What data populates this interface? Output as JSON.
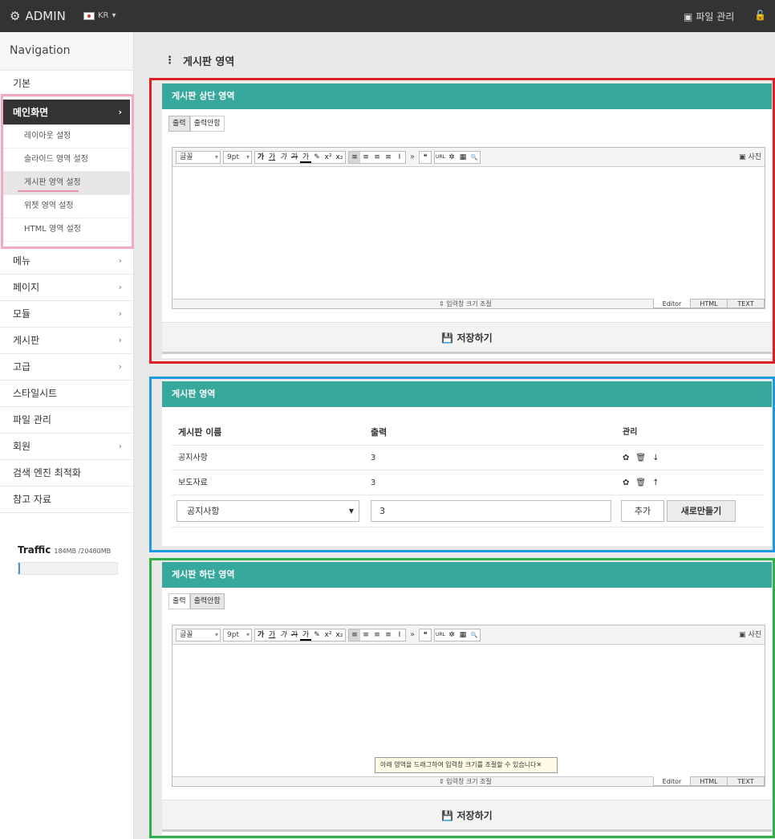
{
  "topbar": {
    "brand": "ADMIN",
    "lang": "KR",
    "file_manager": "파일 관리"
  },
  "sidebar": {
    "title": "Navigation",
    "items": [
      {
        "label": "기본"
      },
      {
        "label": "메인화면"
      },
      {
        "label": "메뉴"
      },
      {
        "label": "페이지"
      },
      {
        "label": "모듈"
      },
      {
        "label": "게시판"
      },
      {
        "label": "고급"
      },
      {
        "label": "스타일시트"
      },
      {
        "label": "파일 관리"
      },
      {
        "label": "회원"
      },
      {
        "label": "검색 엔진 최적화"
      },
      {
        "label": "참고 자료"
      }
    ],
    "sub_items": [
      {
        "label": "레이아웃 설정"
      },
      {
        "label": "슬라이드 영역 설정"
      },
      {
        "label": "게시판 영역 설정"
      },
      {
        "label": "위젯 영역 설정"
      },
      {
        "label": "HTML 영역 설정"
      }
    ],
    "traffic": {
      "label": "Traffic",
      "usage": "184MB /20480MB",
      "fill_fraction": 0.009
    }
  },
  "page": {
    "title": "게시판 영역"
  },
  "top_panel": {
    "title": "게시판 상단 영역",
    "toggle": [
      "출력",
      "출력안함"
    ],
    "save": "저장하기"
  },
  "board_panel": {
    "title": "게시판 영역",
    "headers": [
      "게시판 이름",
      "출력",
      "관리"
    ],
    "rows": [
      {
        "name": "공지사항",
        "count": "3"
      },
      {
        "name": "보도자료",
        "count": "3"
      }
    ],
    "select_value": "공지사항",
    "count_value": "3",
    "add": "추가",
    "new": "새로만들기"
  },
  "bottom_panel": {
    "title": "게시판 하단 영역",
    "toggle": [
      "출력",
      "출력안함"
    ],
    "save": "저장하기",
    "tooltip": "아래 영역을 드래그하여 입력창 크기를 조절할 수 있습니다"
  },
  "editor": {
    "font": "글꼴",
    "size": "9pt",
    "photo": "사진",
    "resize": "입력창 크기 조절",
    "modes": [
      "Editor",
      "HTML",
      "TEXT"
    ],
    "fmt": [
      "가",
      "가",
      "가",
      "가",
      "가"
    ],
    "align": [
      "≡",
      "≡",
      "≡",
      "≡",
      "I"
    ],
    "misc": [
      "❝"
    ],
    "tools": [
      "URL",
      "✲",
      "▦",
      "🔍"
    ]
  },
  "colors": {
    "teal": "#36a89c",
    "red": "#e02020",
    "blue": "#1e9be0",
    "green": "#2fb04a",
    "pink": "#f3a8c7"
  }
}
